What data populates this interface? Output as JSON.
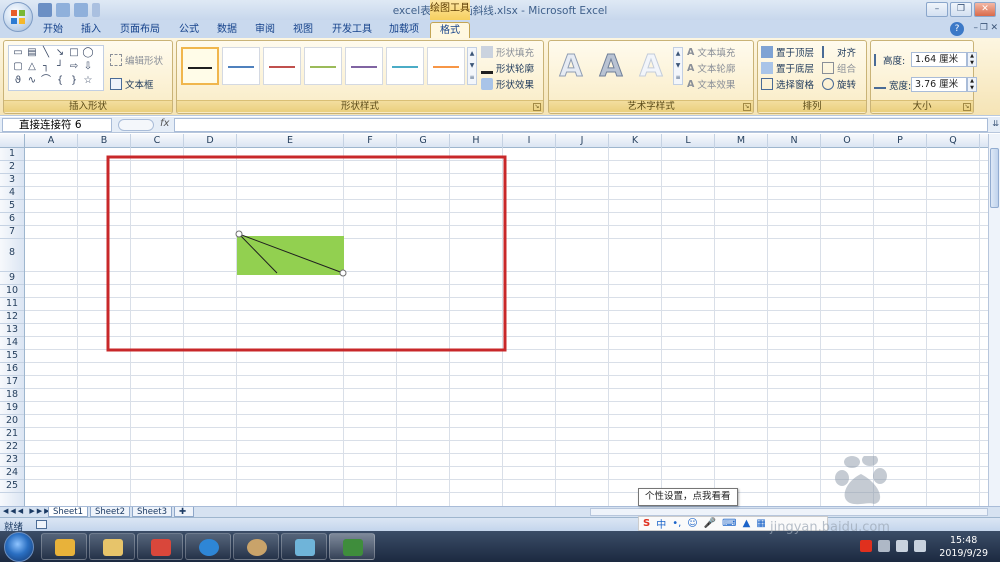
{
  "window": {
    "title": "excel表格如何画斜线.xlsx - Microsoft Excel",
    "context_tab_title": "绘图工具",
    "minimize": "–",
    "restore": "❐",
    "close": "✕"
  },
  "tabs": [
    {
      "label": "开始"
    },
    {
      "label": "插入"
    },
    {
      "label": "页面布局"
    },
    {
      "label": "公式"
    },
    {
      "label": "数据"
    },
    {
      "label": "审阅"
    },
    {
      "label": "视图"
    },
    {
      "label": "开发工具"
    },
    {
      "label": "加载项"
    },
    {
      "label": "格式",
      "active": true
    }
  ],
  "ribbon": {
    "insert_shapes": {
      "label": "插入形状",
      "edit_shape": "编辑形状",
      "text_box": "文本框"
    },
    "shape_styles": {
      "label": "形状样式",
      "fill": "形状填充",
      "outline": "形状轮廓",
      "effects": "形状效果",
      "swatch_colors": [
        "#1f1f1f",
        "#4f81bd",
        "#c0504d",
        "#9bbb59",
        "#8064a2",
        "#4bacc6",
        "#f79646"
      ]
    },
    "art_text": {
      "label": "艺术字样式",
      "text_fill": "文本填充",
      "text_outline": "文本轮廓",
      "text_effects": "文本效果",
      "letter": "A"
    },
    "arrange": {
      "label": "排列",
      "bring_front": "置于顶层",
      "send_back": "置于底层",
      "selection_pane": "选择窗格",
      "align": "对齐",
      "group": "组合",
      "rotate": "旋转"
    },
    "size": {
      "label": "大小",
      "height_label": "高度:",
      "height_value": "1.64 厘米",
      "width_label": "宽度:",
      "width_value": "3.76 厘米"
    }
  },
  "formula_bar": {
    "name_box": "直接连接符 6",
    "fx": "fx",
    "value": ""
  },
  "grid": {
    "columns": [
      "A",
      "B",
      "C",
      "D",
      "E",
      "F",
      "G",
      "H",
      "I",
      "J",
      "K",
      "L",
      "M",
      "N",
      "O",
      "P",
      "Q"
    ],
    "rows": [
      "1",
      "2",
      "3",
      "4",
      "5",
      "6",
      "7",
      "8",
      "9",
      "10",
      "11",
      "12",
      "13",
      "14",
      "15",
      "16",
      "17",
      "18",
      "19",
      "20",
      "21",
      "22",
      "23",
      "24",
      "25"
    ],
    "green_fill": "#92d050",
    "highlight_color": "#c8282a"
  },
  "sheets": [
    {
      "name": "Sheet1",
      "active": true
    },
    {
      "name": "Sheet2"
    },
    {
      "name": "Sheet3"
    }
  ],
  "status": {
    "ready": "就绪",
    "tooltip": "个性设置，点我看看",
    "ime_label": "中"
  },
  "taskbar": {
    "time": "15:48",
    "date": "2019/9/29"
  },
  "watermark": {
    "text": "Bai度经验",
    "url": "jingyan.baidu.com"
  }
}
